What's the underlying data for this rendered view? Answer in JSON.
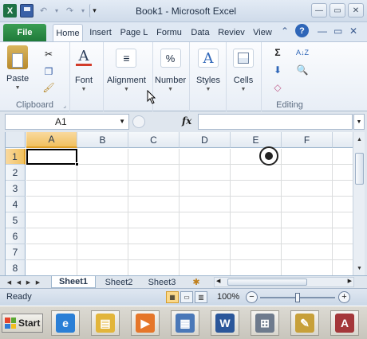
{
  "window": {
    "title": "Book1 - Microsoft Excel",
    "qat": {
      "app_icon": "X",
      "undo_caret": "▾",
      "redo_caret": "▾",
      "customize": "▾"
    },
    "controls": {
      "minimize": "—",
      "restore": "▭",
      "close": "✕"
    },
    "doc_controls": {
      "minimize": "—",
      "restore": "▭",
      "close": "✕"
    }
  },
  "ribbon": {
    "tabs": [
      "File",
      "Home",
      "Insert",
      "Page L",
      "Formu",
      "Data",
      "Reviev",
      "View"
    ],
    "active_tab": "Home",
    "groups": {
      "clipboard": {
        "label": "Clipboard",
        "paste_label": "Paste",
        "launcher": "⌟"
      },
      "font": {
        "label": "Font",
        "icon_text": "A"
      },
      "alignment": {
        "label": "Alignment"
      },
      "number": {
        "label": "Number",
        "icon_text": "%"
      },
      "styles": {
        "label": "Styles",
        "icon_text": "A"
      },
      "cells": {
        "label": "Cells"
      },
      "editing": {
        "label": "Editing",
        "sum_icon": "Σ",
        "sort_icon": "A↓Z"
      }
    }
  },
  "formula_bar": {
    "name_box": "A1",
    "fx_label": "fx",
    "formula": ""
  },
  "grid": {
    "columns": [
      "A",
      "B",
      "C",
      "D",
      "E",
      "F"
    ],
    "rows": [
      "1",
      "2",
      "3",
      "4",
      "5",
      "6",
      "7",
      "8"
    ],
    "selected_column": "A",
    "selected_row": "1",
    "active_cell": "A1"
  },
  "sheets": {
    "tabs": [
      "Sheet1",
      "Sheet2",
      "Sheet3"
    ],
    "active": "Sheet1",
    "insert_icon": "✱"
  },
  "status_bar": {
    "status": "Ready",
    "zoom": "100%",
    "zoom_out": "−",
    "zoom_in": "+"
  },
  "taskbar": {
    "start_label": "Start",
    "items": [
      {
        "name": "internet-explorer",
        "glyph": "e",
        "color": "#2a7fd6"
      },
      {
        "name": "windows-explorer",
        "glyph": "▤",
        "color": "#e2b53b"
      },
      {
        "name": "media-player",
        "glyph": "▶",
        "color": "#e5762a"
      },
      {
        "name": "network",
        "glyph": "▦",
        "color": "#4a78b8"
      },
      {
        "name": "word",
        "glyph": "W",
        "color": "#2b579a"
      },
      {
        "name": "calculator",
        "glyph": "⊞",
        "color": "#6e7b8d"
      },
      {
        "name": "paint",
        "glyph": "✎",
        "color": "#c7a03a"
      },
      {
        "name": "access",
        "glyph": "A",
        "color": "#a4373a"
      }
    ]
  }
}
